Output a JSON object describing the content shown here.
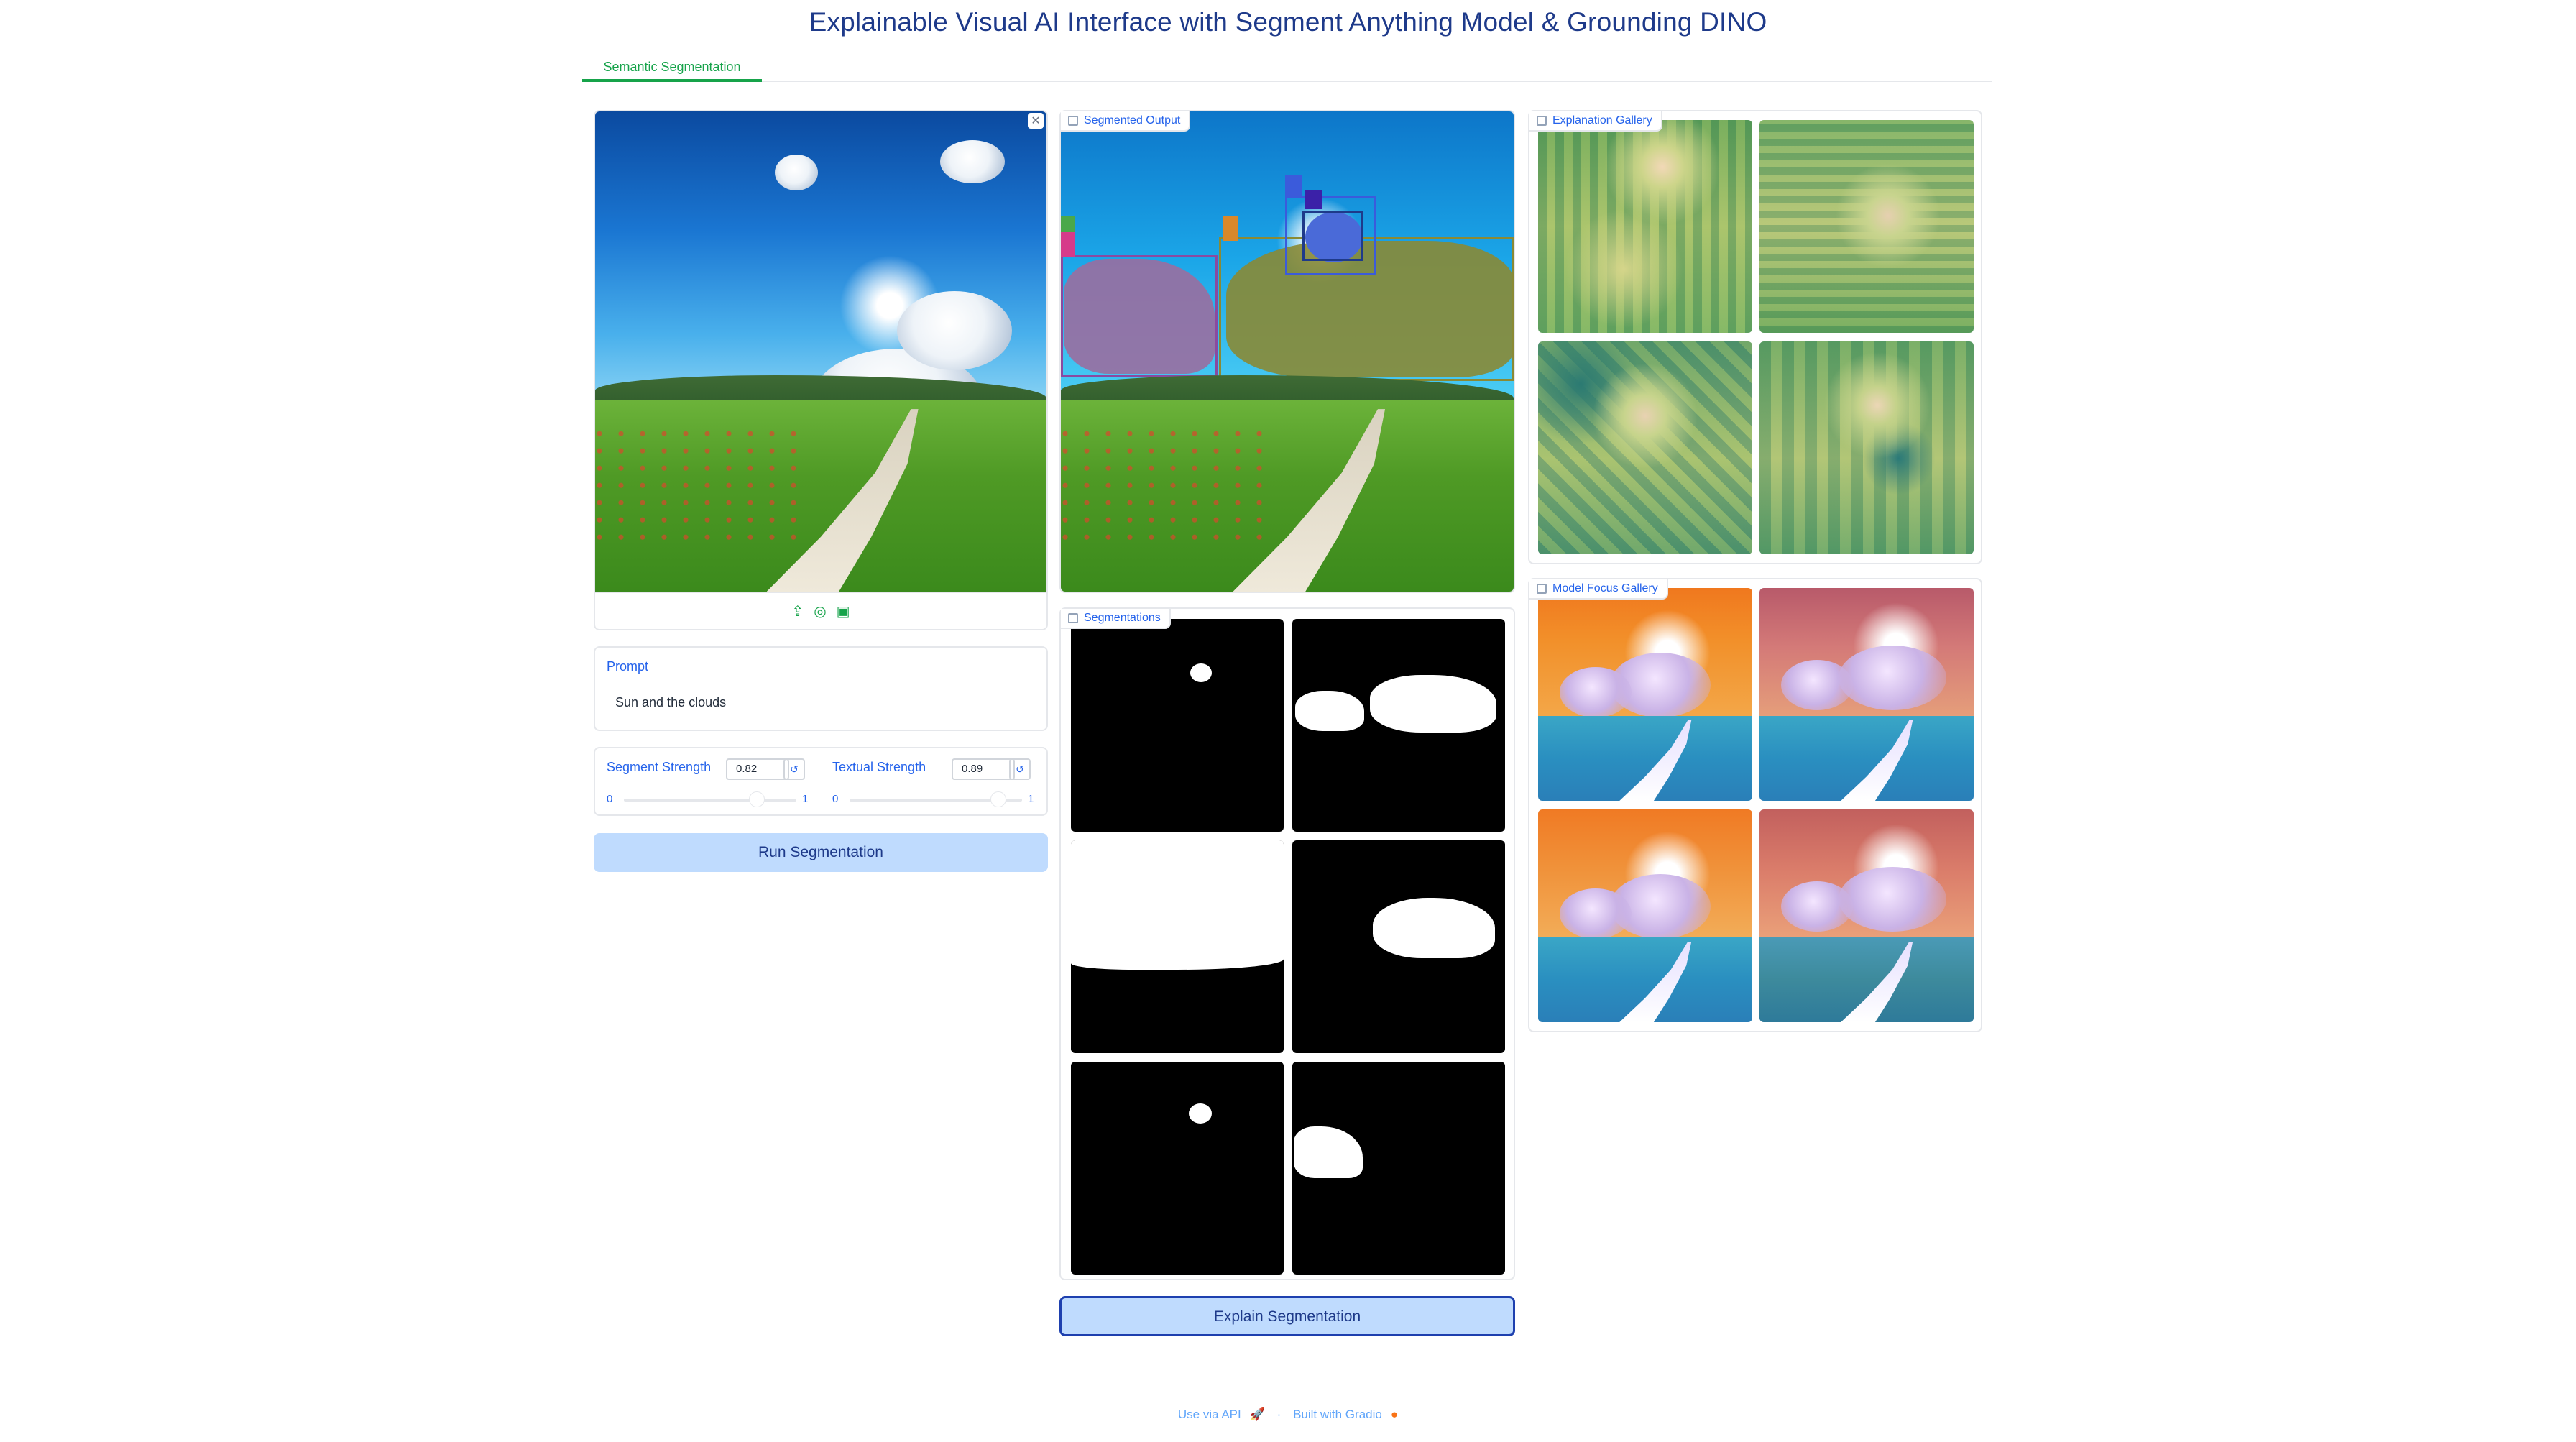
{
  "app": {
    "title": "Explainable Visual AI Interface with Segment Anything Model & Grounding DINO"
  },
  "tabs": [
    {
      "label": "Semantic Segmentation"
    }
  ],
  "input_panel": {
    "upload_icon": "upload-icon",
    "webcam_icon": "webcam-icon",
    "clipboard_icon": "clipboard-icon"
  },
  "prompt": {
    "label": "Prompt",
    "value": "Sun and the clouds"
  },
  "segment_strength": {
    "label": "Segment Strength",
    "value": "0.82",
    "min": "0",
    "max": "1",
    "fraction": 0.82
  },
  "textual_strength": {
    "label": "Textual Strength",
    "value": "0.89",
    "min": "0",
    "max": "1",
    "fraction": 0.89
  },
  "buttons": {
    "run": "Run Segmentation",
    "explain": "Explain Segmentation"
  },
  "segmented_output": {
    "label": "Segmented Output"
  },
  "segmentations": {
    "label": "Segmentations"
  },
  "explanation_gallery": {
    "label": "Explanation Gallery"
  },
  "model_focus_gallery": {
    "label": "Model Focus Gallery"
  },
  "footer": {
    "api": "Use via API",
    "separator": "·",
    "built": "Built with Gradio"
  },
  "colors": {
    "accent": "#16a34a",
    "primary_button": "#bfdbfe",
    "text": "#1e3a8a"
  }
}
